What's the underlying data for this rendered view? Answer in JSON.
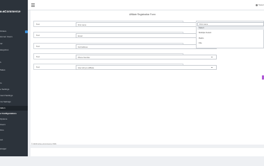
{
  "sidebar": {
    "brand": "e eCommerce",
    "items": [
      {
        "label": "board",
        "state": "normal"
      },
      {
        "label": "Orders",
        "state": "normal"
      },
      {
        "label": "stomer Users",
        "state": "normal"
      },
      {
        "label": "Inf",
        "state": "normal"
      },
      {
        "label": "ategories",
        "state": "normal"
      },
      {
        "label": "h",
        "state": "normal"
      },
      {
        "label": "Sales",
        "state": "normal"
      },
      {
        "label": "rs",
        "state": "normal"
      },
      {
        "label": "e Settings",
        "state": "normal"
      },
      {
        "label": "ment Settings",
        "state": "normal"
      },
      {
        "label": "ms Settings",
        "state": "normal"
      },
      {
        "label": "ration",
        "state": "active"
      },
      {
        "label": "e Configurations",
        "state": "bold"
      },
      {
        "label": "Options",
        "state": "normal"
      },
      {
        "label": "Users",
        "state": "normal"
      },
      {
        "label": "Ons",
        "state": "normal"
      },
      {
        "label": "out",
        "state": "normal"
      },
      {
        "label": "anager",
        "state": "normal"
      }
    ]
  },
  "topbar": {
    "user_label": "Super"
  },
  "form": {
    "title": "Affiliate Registration Form",
    "rows": [
      {
        "label": "Text",
        "value": "First name"
      },
      {
        "label": "Text",
        "value": "Email"
      },
      {
        "label": "Text",
        "value": "Full Address"
      },
      {
        "label": "Text",
        "value": "Phone Number"
      },
      {
        "label": "Text",
        "value": "How will you affiliate"
      }
    ]
  },
  "dropdown": {
    "search_value": "First name",
    "options": [
      "Select",
      "Multiple Select",
      "Radio",
      "File"
    ],
    "highlighted_index": 0
  },
  "footer": {
    "note": "© 2023 Active eCommerce CMS"
  },
  "colors": {
    "sidebar_bg": "#2c333b",
    "accent_purple": "#b05ad6",
    "badge_blue": "#3b8fd9"
  }
}
